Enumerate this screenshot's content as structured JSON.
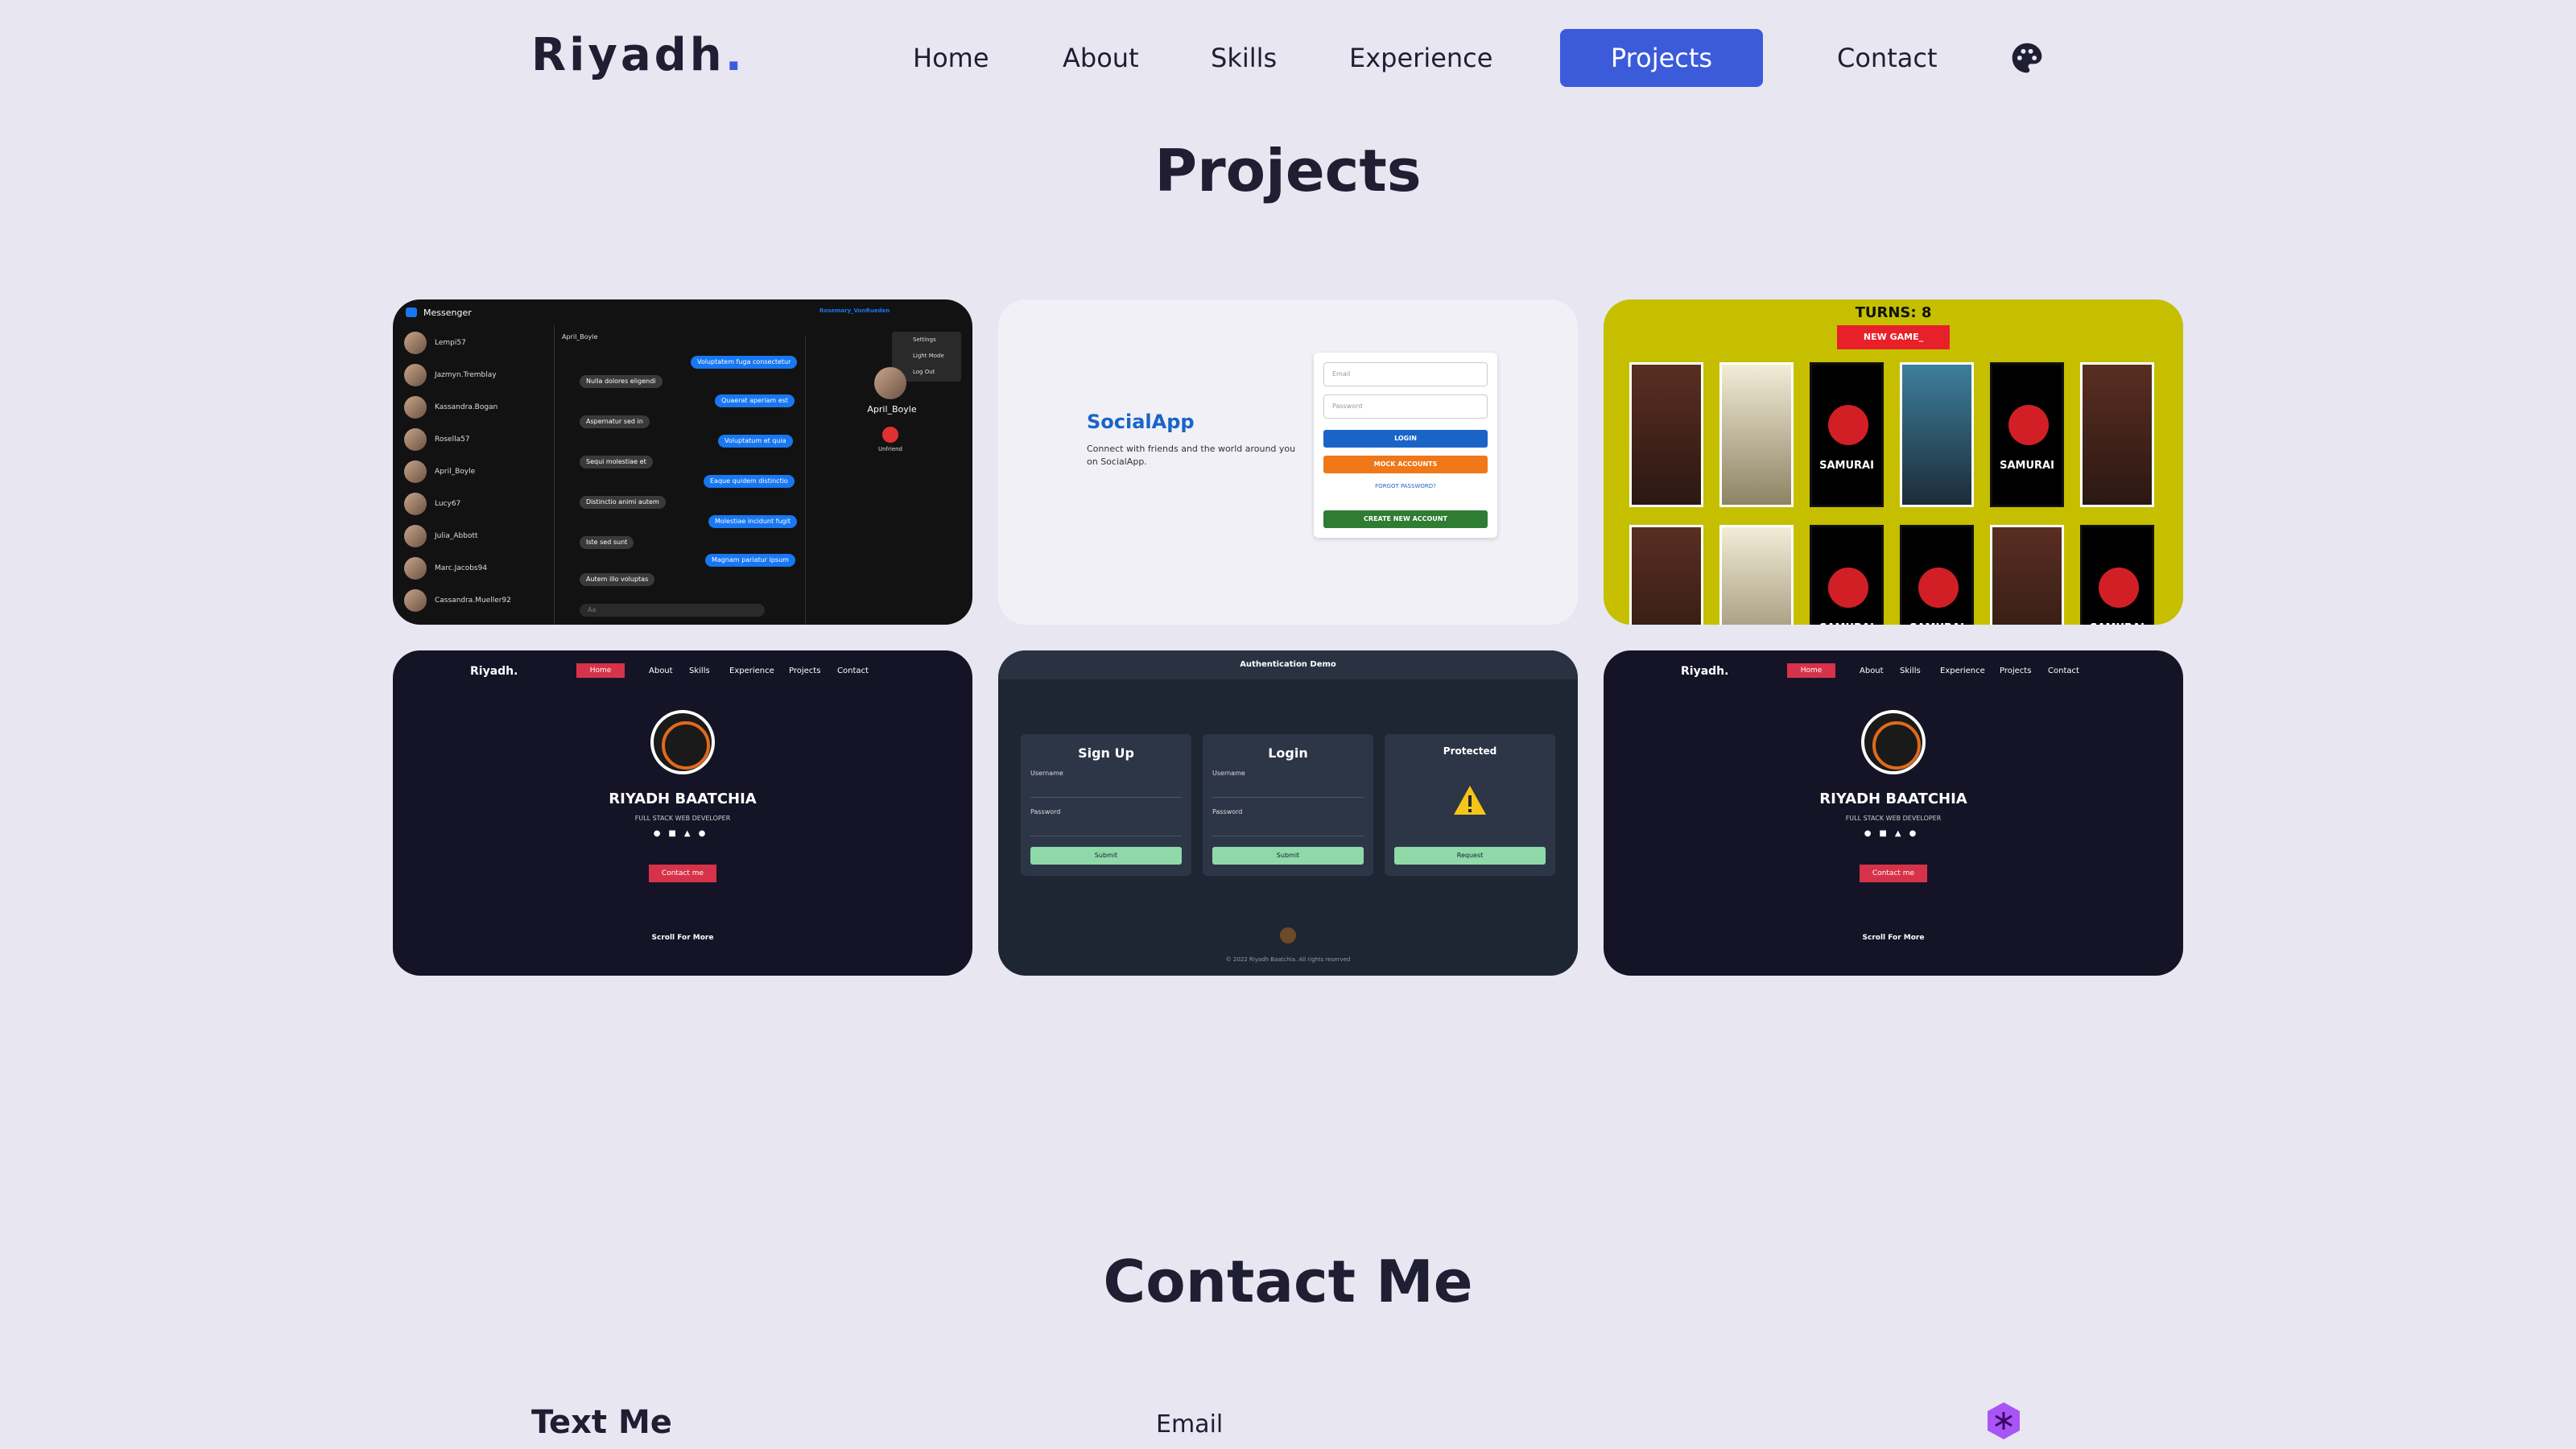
{
  "nav": {
    "logo": "Riyadh",
    "logo_dot": ".",
    "items": [
      "Home",
      "About",
      "Skills",
      "Experience",
      "Projects",
      "Contact"
    ]
  },
  "projects": {
    "title": "Projects"
  },
  "messenger": {
    "app": "Messenger",
    "user": "Rosemary_VonRueden",
    "menu": [
      "Settings",
      "Light Mode",
      "Log Out"
    ],
    "contacts": [
      "Lempi57",
      "Jazmyn.Tremblay",
      "Kassandra.Bogan",
      "Rosella57",
      "April_Boyle",
      "Lucy67",
      "Julia_Abbott",
      "Marc.Jacobs94",
      "Cassandra.Mueller92"
    ],
    "chat_with": "April_Boyle",
    "profile_name": "April_Boyle",
    "profile_action": "Unfriend",
    "msgs_in": [
      "Nulla dolores eligendi",
      "Aspernatur sed in",
      "Sequi molestiae et",
      "Distinctio animi autem",
      "Iste sed sunt",
      "Autem illo voluptas"
    ],
    "msgs_out": [
      "Voluptatem fuga consectetur",
      "Quaerat aperiam est",
      "Voluptatum et quia",
      "Eaque quidem distinctio",
      "Molestiae incidunt fugit",
      "Magnam pariatur ipsum"
    ],
    "composer_placeholder": "Aa"
  },
  "social": {
    "title": "SocialApp",
    "desc": "Connect with friends and the world around you on SocialApp.",
    "email": "Email",
    "password": "Password",
    "login": "LOGIN",
    "mock": "MOCK ACCOUNTS",
    "forgot": "FORGOT PASSWORD?",
    "create": "CREATE NEW ACCOUNT"
  },
  "game": {
    "turns": "TURNS: 8",
    "new_game": "NEW GAME_",
    "samurai": "SAMURAI"
  },
  "portfolio": {
    "logo": "Riyadh.",
    "items": [
      "Home",
      "About",
      "Skills",
      "Experience",
      "Projects",
      "Contact"
    ],
    "name": "RIYADH BAATCHIA",
    "role": "FULL STACK WEB DEVELOPER",
    "cta": "Contact me",
    "scroll": "Scroll For More"
  },
  "auth": {
    "title": "Authentication Demo",
    "signup": "Sign Up",
    "login": "Login",
    "protected": "Protected",
    "username": "Username",
    "password": "Password",
    "submit": "Submit",
    "request": "Request",
    "footer": "© 2022 Riyadh Baatchia. All rights reserved"
  },
  "contact": {
    "title": "Contact Me",
    "text_me": "Text Me",
    "email": "Email"
  },
  "colors": {
    "accent": "#3b5bdb",
    "bg": "#e8e6f1"
  }
}
